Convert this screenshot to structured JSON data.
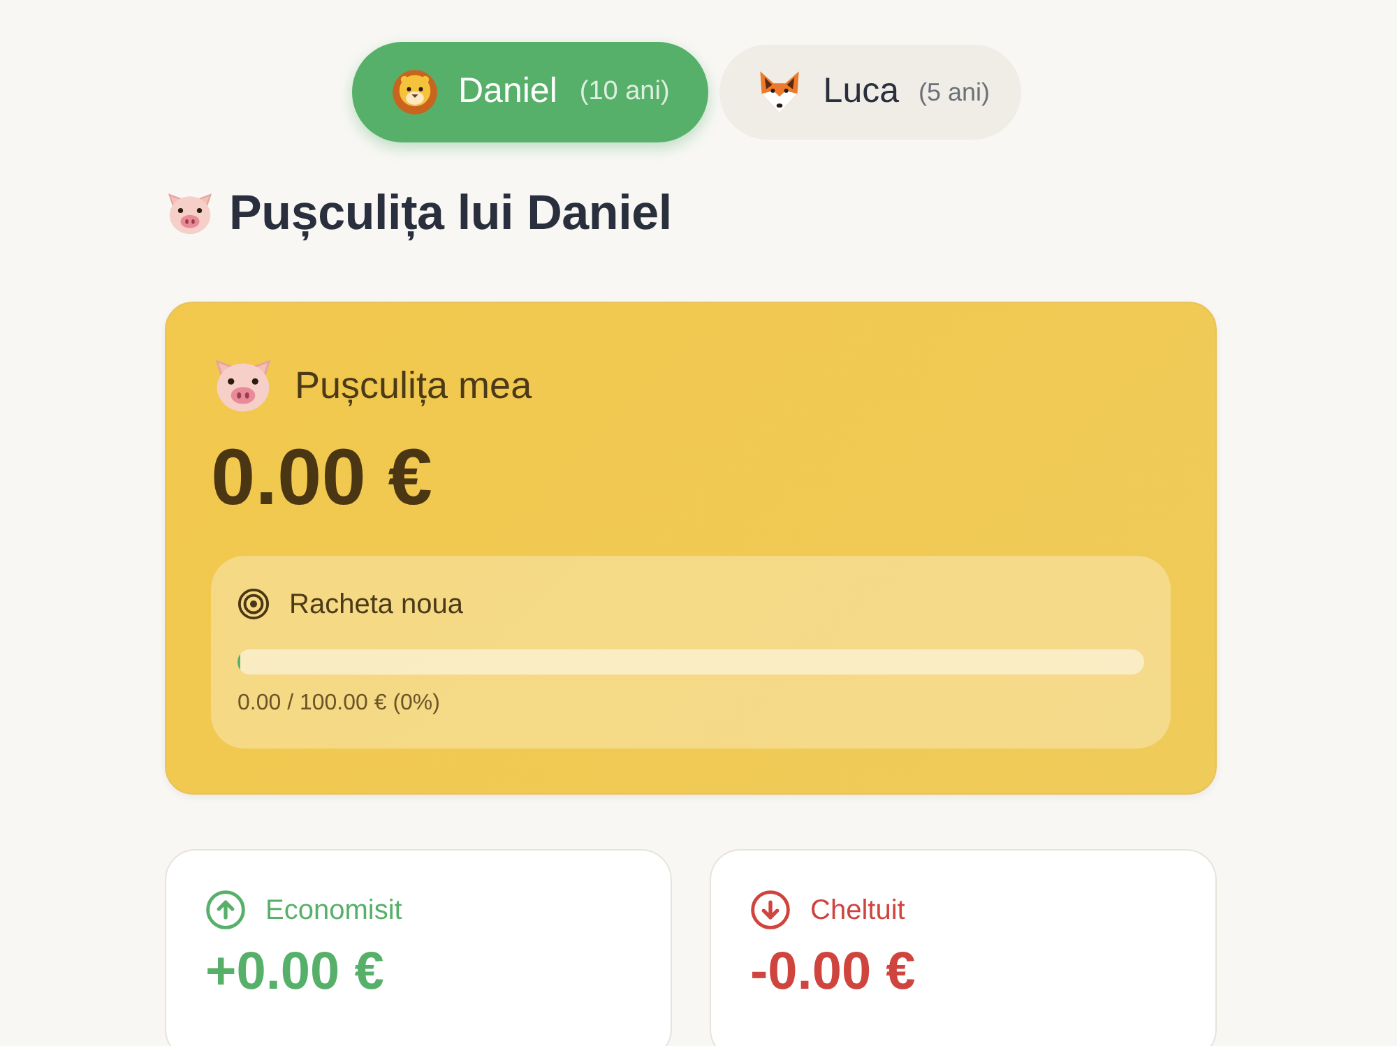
{
  "tabs": [
    {
      "name": "Daniel",
      "age": "(10 ani)",
      "kind": "lion",
      "selected": true
    },
    {
      "name": "Luca",
      "age": "(5 ani)",
      "kind": "fox",
      "selected": false
    }
  ],
  "heading": {
    "title": "Pușculița lui Daniel"
  },
  "balance_card": {
    "label": "Pușculița mea",
    "amount": "0.00 €",
    "goal": {
      "name": "Racheta noua",
      "level": 0,
      "progress": "0.00 / 100.00 € (0%)"
    }
  },
  "stats": [
    {
      "kind": "saved",
      "label": "Economisit",
      "amount": "+0.00 €"
    },
    {
      "kind": "spent",
      "label": "Cheltuit",
      "amount": "-0.00 €"
    }
  ]
}
